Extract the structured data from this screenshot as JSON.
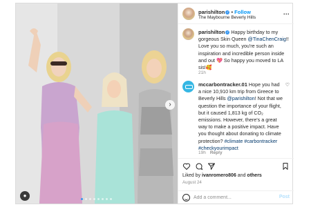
{
  "post": {
    "author": "parishilton",
    "follow_label": "Follow",
    "location": "The Maybourne Beverly Hills",
    "more_label": "...",
    "dots_total": 8,
    "dots_active": 0
  },
  "comments": [
    {
      "user": "parishilton",
      "pre": " Happy birthday to my gorgeous Skin Queen ",
      "mention": "@TinaChenCraig",
      "post": "!! Love you so much, you're such an inspiration and incredible person inside and out 💖 So happy you moved to LA sis!🥰",
      "time": "21h",
      "reply": ""
    },
    {
      "user": "mccarbontracker.01",
      "pre": " Hope you had a nice 10,910 km trip from Greece to Beverly Hills ",
      "mention": "@parishilton",
      "post": "! Not that we question the importance of your flight, but it caused 1,813 kg of CO₂ emissions. However, there's a great way to make a positive impact. Have you thought about donating to climate protection? ",
      "tags": "#climate #carbontracker #checkyourimpact",
      "time": "19h",
      "reply": "Reply"
    }
  ],
  "likes": {
    "prefix": "Liked by ",
    "user": "ivanromero806",
    "middle": " and ",
    "others": "others"
  },
  "date": "August 24",
  "add_comment": {
    "placeholder": "Add a comment...",
    "post_label": "Post"
  },
  "icons": {
    "heart": "heart-icon",
    "comment": "comment-icon",
    "share": "share-icon",
    "save": "bookmark-icon",
    "emoji": "emoji-icon"
  },
  "colors": {
    "link_blue": "#0095f6",
    "mention": "#00376b",
    "muted": "#8e8e8e"
  }
}
